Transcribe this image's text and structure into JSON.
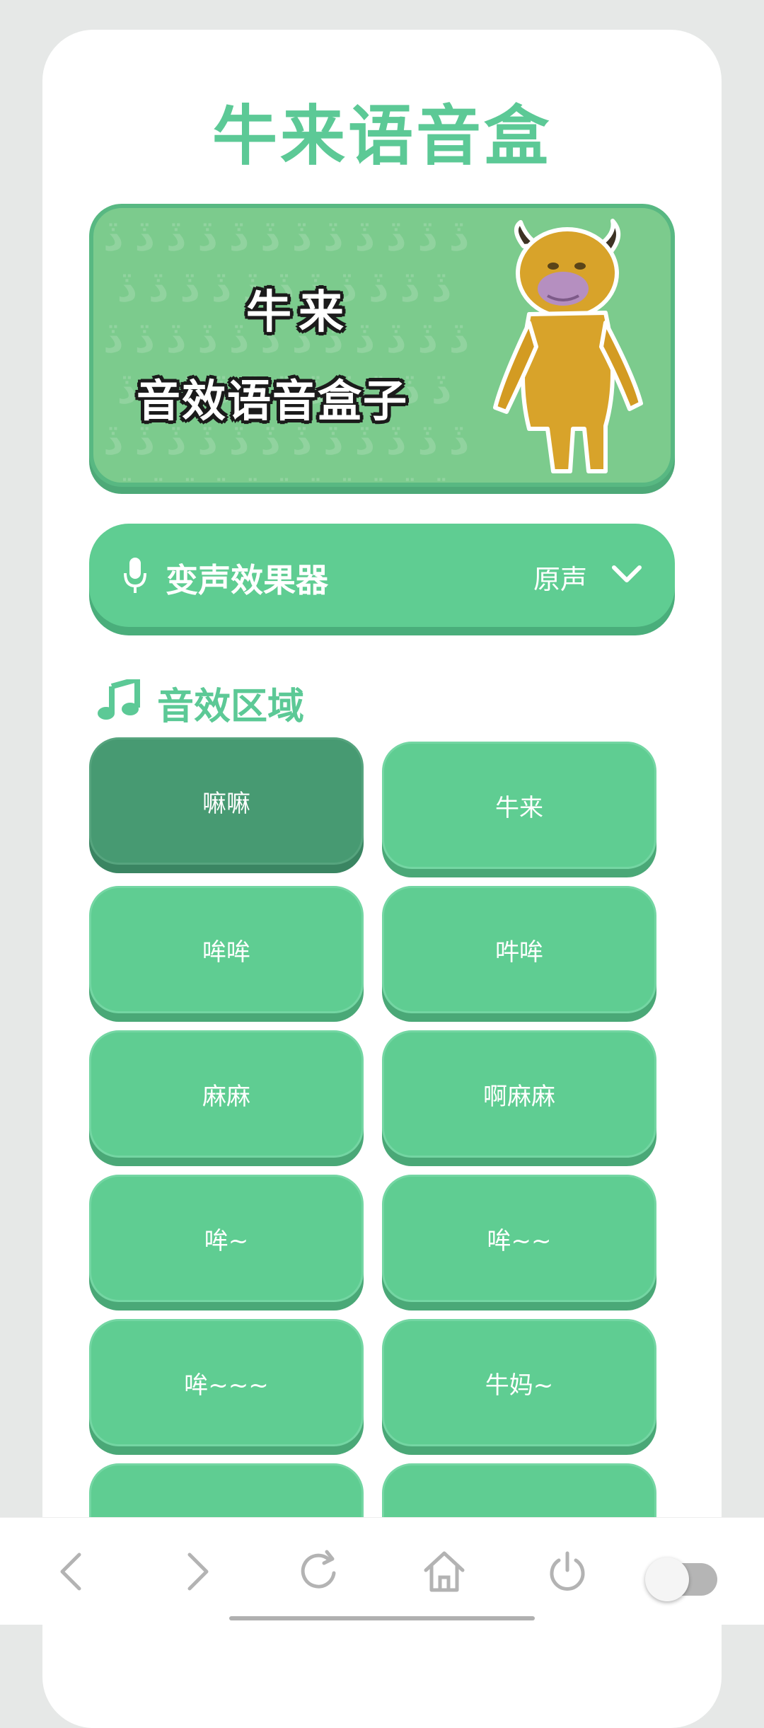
{
  "app": {
    "title": "牛来语音盒"
  },
  "banner": {
    "line1": "牛来",
    "line2": "音效语音盒子"
  },
  "voice_changer": {
    "label": "变声效果器",
    "value": "原声",
    "icon": "mic-icon",
    "dropdown_icon": "chevron-down-icon"
  },
  "section": {
    "title": "音效区域",
    "icon": "music-note-icon"
  },
  "sounds": [
    {
      "label": "嘛嘛",
      "active": true
    },
    {
      "label": "牛来",
      "active": false
    },
    {
      "label": "哞哞",
      "active": false
    },
    {
      "label": "吽哞",
      "active": false
    },
    {
      "label": "麻麻",
      "active": false
    },
    {
      "label": "啊麻麻",
      "active": false
    },
    {
      "label": "哞~",
      "active": false
    },
    {
      "label": "哞~~",
      "active": false
    },
    {
      "label": "哞~~~",
      "active": false
    },
    {
      "label": "牛妈~",
      "active": false
    },
    {
      "label": "",
      "active": false
    },
    {
      "label": "",
      "active": false
    }
  ],
  "bottom_nav": {
    "items": [
      "back-icon",
      "forward-icon",
      "refresh-icon",
      "home-icon",
      "power-icon"
    ],
    "toggle_on": false
  },
  "colors": {
    "accent": "#5cc996",
    "button": "#5fcd92",
    "button_active": "#479a72",
    "background": "#e6e8e7"
  }
}
